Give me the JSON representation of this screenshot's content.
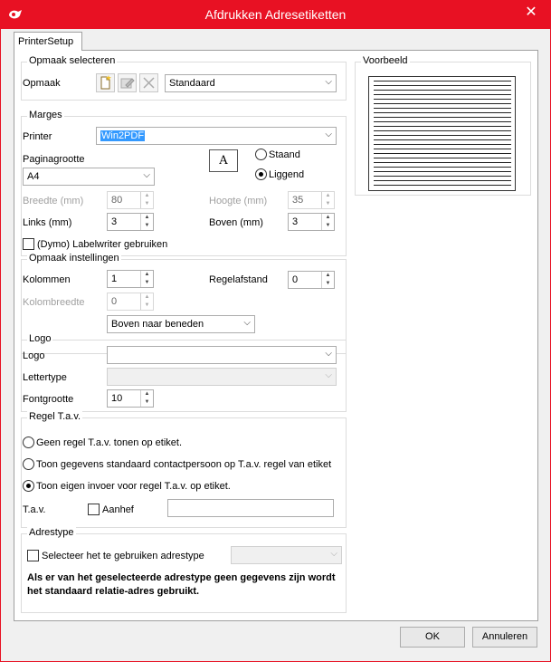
{
  "window": {
    "title": "Afdrukken Adresetiketten",
    "close_glyph": "✕"
  },
  "tab": {
    "label": "PrinterSetup"
  },
  "opmaak_selecteren": {
    "title": "Opmaak selecteren",
    "label": "Opmaak",
    "value": "Standaard",
    "icons": [
      "new-document-icon",
      "edit-icon",
      "delete-icon"
    ]
  },
  "marges": {
    "title": "Marges",
    "printer_label": "Printer",
    "printer_value": "Win2PDF",
    "paginagrootte_label": "Paginagrootte",
    "paginagrootte_value": "A4",
    "orientation_icon_text": "A",
    "staand_label": "Staand",
    "liggend_label": "Liggend",
    "breedte_label": "Breedte (mm)",
    "breedte_value": "80",
    "hoogte_label": "Hoogte (mm)",
    "hoogte_value": "35",
    "links_label": "Links (mm)",
    "links_value": "3",
    "boven_label": "Boven (mm)",
    "boven_value": "3",
    "dymo_label": "(Dymo) Labelwriter gebruiken"
  },
  "opmaak_instellingen": {
    "title": "Opmaak instellingen",
    "kolommen_label": "Kolommen",
    "kolommen_value": "1",
    "regelafstand_label": "Regelafstand",
    "regelafstand_value": "0",
    "kolombreedte_label": "Kolombreedte",
    "kolombreedte_value": "0",
    "richting_value": "Boven naar beneden"
  },
  "logo": {
    "title": "Logo",
    "logo_label": "Logo",
    "logo_value": "",
    "lettertype_label": "Lettertype",
    "lettertype_value": "",
    "fontgrootte_label": "Fontgrootte",
    "fontgrootte_value": "10"
  },
  "regel_tav": {
    "title": "Regel T.a.v.",
    "option1": "Geen regel T.a.v. tonen op etiket.",
    "option2": "Toon gegevens standaard contactpersoon op T.a.v. regel van etiket",
    "option3": "Toon eigen invoer voor regel T.a.v. op etiket.",
    "tav_label": "T.a.v.",
    "aanhef_label": "Aanhef",
    "tav_value": ""
  },
  "adrestype": {
    "title": "Adrestype",
    "checkbox_label": "Selecteer het te gebruiken adrestype",
    "value": "",
    "note": "Als er van het geselecteerde adrestype geen gegevens zijn wordt het standaard relatie-adres gebruikt."
  },
  "voorbeeld": {
    "title": "Voorbeeld"
  },
  "buttons": {
    "ok": "OK",
    "cancel": "Annuleren"
  }
}
